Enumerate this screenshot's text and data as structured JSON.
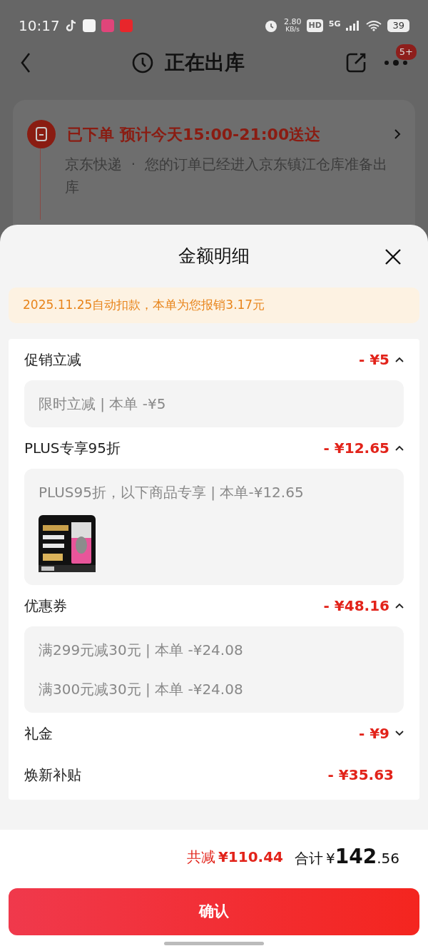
{
  "status_bar": {
    "time": "10:17",
    "speed_value": "2.80",
    "speed_unit": "KB/s",
    "hd": "HD",
    "network": "5G",
    "battery": "39"
  },
  "header": {
    "title": "正在出库",
    "badge": "5+"
  },
  "order_card": {
    "status": "已下单",
    "eta": "预计今天15:00-21:00送达",
    "carrier": "京东快递",
    "separator": "·",
    "message": "您的订单已经进入京东镇江仓库准备出库"
  },
  "sheet": {
    "title": "金额明细",
    "notice": "2025.11.25自动扣款，本单为您报销3.17元",
    "sections": [
      {
        "kind": "expandable",
        "label": "促销立减",
        "amount": "- ¥5",
        "expanded": true,
        "details": [
          {
            "text": "限时立减 | 本单 -¥5"
          }
        ]
      },
      {
        "kind": "expandable",
        "label": "PLUS专享95折",
        "amount": "- ¥12.65",
        "expanded": true,
        "details": [
          {
            "text": "PLUS95折，以下商品专享 | 本单-¥12.65",
            "kind": "picture"
          }
        ]
      },
      {
        "kind": "expandable",
        "label": "优惠券",
        "amount": "- ¥48.16",
        "expanded": true,
        "details": [
          {
            "text": "满299元减30元 | 本单 -¥24.08"
          },
          {
            "text": "满300元减30元 | 本单 -¥24.08"
          }
        ]
      },
      {
        "kind": "expandable",
        "label": "礼金",
        "amount": "- ¥9",
        "expanded": false
      },
      {
        "kind": "plain",
        "label": "焕新补贴",
        "amount": "- ¥35.63"
      }
    ],
    "summary": {
      "discount_label": "共减",
      "discount": "¥110.44",
      "total_label": "合计",
      "total_currency": "¥",
      "total_integer": "142",
      "total_decimal": ".56"
    },
    "confirm": "确认"
  }
}
